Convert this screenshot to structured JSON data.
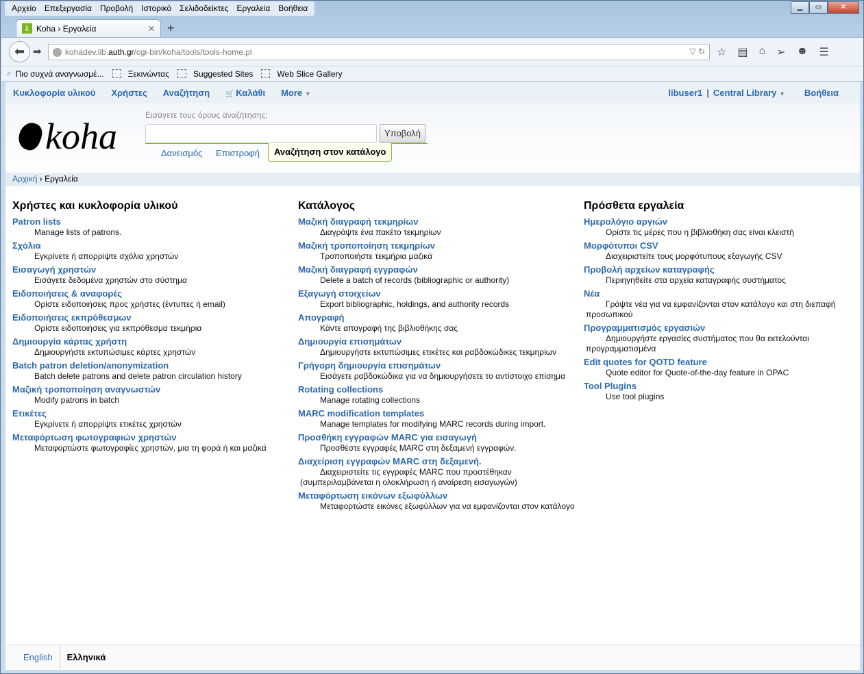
{
  "browser": {
    "menu": [
      "Αρχείο",
      "Επεξεργασία",
      "Προβολή",
      "Ιστορικό",
      "Σελιδοδείκτες",
      "Εργαλεία",
      "Βοήθεια"
    ],
    "tab_title": "Koha › Εργαλεία",
    "url_host_pre": "kohadev.lib.",
    "url_host_main": "auth.gr",
    "url_path": "/cgi-bin/koha/tools/tools-home.pl",
    "bookmarks": [
      "Πιο συχνά αναγνωσμέ...",
      "Ξεκινώντας",
      "Suggested Sites",
      "Web Slice Gallery"
    ]
  },
  "koha_nav": {
    "items": [
      "Κυκλοφορία υλικού",
      "Χρήστες",
      "Αναζήτηση",
      "Καλάθι",
      "More"
    ],
    "user": "libuser1",
    "library": "Central Library",
    "help": "Βοήθεια"
  },
  "header": {
    "logo": "koha",
    "search_hint": "Εισάγετε τους όρους αναζήτησης:",
    "search_value": "",
    "submit": "Υποβολή",
    "tabs": [
      "Δανεισμός",
      "Επιστροφή",
      "Αναζήτηση στον κατάλογο"
    ]
  },
  "breadcrumb": {
    "home": "Αρχική",
    "current": "Εργαλεία"
  },
  "columns": [
    {
      "title": "Χρήστες και κυκλοφορία υλικού",
      "items": [
        {
          "link": "Patron lists",
          "desc": "Manage lists of patrons."
        },
        {
          "link": "Σχόλια",
          "desc": "Εγκρίνετε ή απορρίψτε σχόλια χρηστών"
        },
        {
          "link": "Εισαγωγή χρηστών",
          "desc": "Εισάγετε δεδομένα χρηστών στο σύστημα"
        },
        {
          "link": "Ειδοποιήσεις & αναφορές",
          "desc": "Ορίστε ειδοποιήσεις προς χρήστες (έντυπες ή email)"
        },
        {
          "link": "Ειδοποιήσεις εκπρόθεσμων",
          "desc": "Ορίστε ειδοποιήσεις για εκπρόθεσμα τεκμήρια"
        },
        {
          "link": "Δημιουργία κάρτας χρήστη",
          "desc": "Δημιουργήστε εκτυπώσιμες κάρτες χρηστών"
        },
        {
          "link": "Batch patron deletion/anonymization",
          "desc": "Batch delete patrons and delete patron circulation history"
        },
        {
          "link": "Μαζική τροποποίηση αναγνωστών",
          "desc": "Modify patrons in batch"
        },
        {
          "link": "Ετικέτες",
          "desc": "Εγκρίνετε ή απορρίψτε ετικέτες χρηστών"
        },
        {
          "link": "Μεταφόρτωση φωτογραφιών χρηστών",
          "desc": "Μεταφορτώστε φωτογραφίες χρηστών, μια τη φορά ή και μαζικά"
        }
      ]
    },
    {
      "title": "Κατάλογος",
      "items": [
        {
          "link": "Μαζική διαγραφή τεκμηρίων",
          "desc": "Διαγράψτε ένα πακέτο τεκμηρίων"
        },
        {
          "link": "Μαζική τροποποίηση τεκμηρίων",
          "desc": "Τροποποιήστε τεκμήρια μαζικά"
        },
        {
          "link": "Μαζική διαγραφή εγγραφών",
          "desc": "Delete a batch of records (bibliographic or authority)"
        },
        {
          "link": "Εξαγωγή στοιχείων",
          "desc": "Export bibliographic, holdings, and authority records"
        },
        {
          "link": "Απογραφή",
          "desc": "Κάντε απογραφή της βιβλιοθήκης σας"
        },
        {
          "link": "Δημιουργία επισημάτων",
          "desc": "Δημιουργήστε εκτυπώσιμες ετικέτες και ραβδοκώδικες τεκμηρίων"
        },
        {
          "link": "Γρήγορη δημιουργία επισημάτων",
          "desc": "Εισάγετε ραβδοκώδικα για να δημιουργήσετε το αντίστοιχο επίσημα"
        },
        {
          "link": "Rotating collections",
          "desc": "Manage rotating collections"
        },
        {
          "link": "MARC modification templates",
          "desc": "Manage templates for modifying MARC records during import."
        },
        {
          "link": "Προσθήκη εγγραφών MARC για εισαγωγή",
          "desc": "Προσθέστε εγγραφές MARC στη δεξαμενή εγγραφών."
        },
        {
          "link": "Διαχείριση εγγραφών MARC στη δεξαμενή.",
          "desc": "Διαχειριστείτε τις εγγραφές MARC που προστέθηκαν (συμπεριλαμβάνεται η ολοκλήρωση ή αναίρεση εισαγωγών)"
        },
        {
          "link": "Μεταφόρτωση εικόνων εξωφύλλων",
          "desc": "Μεταφορτώστε εικόνες εξωφύλλων για να εμφανίζονται στον κατάλογο"
        }
      ]
    },
    {
      "title": "Πρόσθετα εργαλεία",
      "items": [
        {
          "link": "Ημερολόγιο αργιών",
          "desc": "Ορίστε τις μέρες που η βιβλιοθήκη σας είναι κλειστή"
        },
        {
          "link": "Μορφότυποι CSV",
          "desc": "Διαχειριστείτε τους μορφότυπους εξαγωγής CSV"
        },
        {
          "link": "Προβολή αρχείων καταγραφής",
          "desc": "Περιηγηθείτε στα αρχεία καταγραφής συστήματος"
        },
        {
          "link": "Νέα",
          "desc": "Γράψτε νέα για να εμφανίζονται στον κατάλογο και στη διεπαφή προσωπικού"
        },
        {
          "link": "Προγραμματισμός εργασιών",
          "desc": "Δημιουργήστε εργασίες συστήματος που θα εκτελούνται προγραμματισμένα"
        },
        {
          "link": "Edit quotes for QOTD feature",
          "desc": "Quote editor for Quote-of-the-day feature in OPAC"
        },
        {
          "link": "Tool Plugins",
          "desc": "Use tool plugins"
        }
      ]
    }
  ],
  "footer": {
    "languages": [
      "English",
      "Ελληνικά"
    ]
  }
}
